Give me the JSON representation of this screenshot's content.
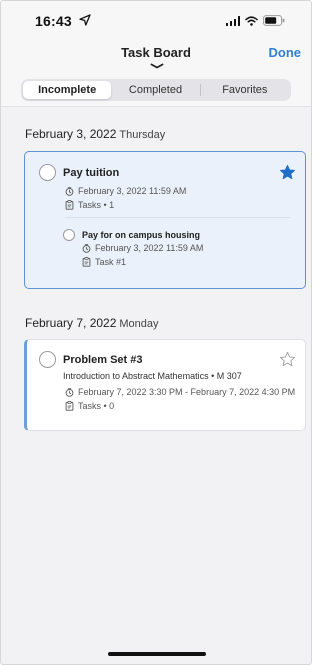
{
  "status_bar": {
    "time": "16:43"
  },
  "nav": {
    "title": "Task Board",
    "done_label": "Done"
  },
  "tabs": [
    {
      "label": "Incomplete",
      "active": true
    },
    {
      "label": "Completed",
      "active": false
    },
    {
      "label": "Favorites",
      "active": false
    }
  ],
  "groups": [
    {
      "date": "February 3, 2022",
      "weekday": "Thursday",
      "task": {
        "title": "Pay tuition",
        "due": "February 3, 2022 11:59 AM",
        "tasks_count": "Tasks • 1",
        "favorited": true,
        "subtask": {
          "title": "Pay for on campus housing",
          "due": "February 3, 2022 11:59 AM",
          "task_label": "Task #1"
        }
      }
    },
    {
      "date": "February 7, 2022",
      "weekday": "Monday",
      "task": {
        "title": "Problem Set #3",
        "course": "Introduction to Abstract Mathematics • M 307",
        "due": "February 7, 2022 3:30 PM - February 7, 2022 4:30 PM",
        "tasks_count": "Tasks • 0",
        "favorited": false
      }
    }
  ],
  "colors": {
    "accent": "#2f7fd3",
    "star_filled": "#1f6fc6",
    "selected_bg": "#eaf1fa",
    "selected_border": "#5b93d3"
  },
  "icons": [
    "location-arrow-icon",
    "signal-icon",
    "wifi-icon",
    "battery-icon",
    "clock-icon",
    "clipboard-icon",
    "star-icon"
  ]
}
